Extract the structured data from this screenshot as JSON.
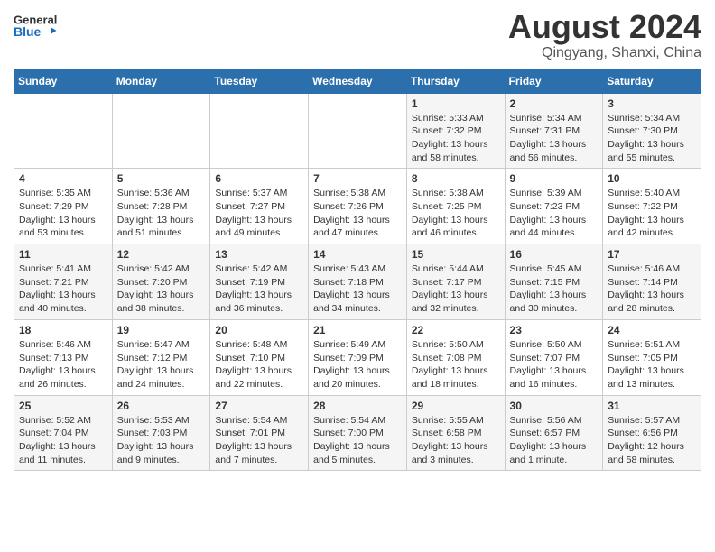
{
  "logo": {
    "line1": "General",
    "line2": "Blue"
  },
  "title": "August 2024",
  "location": "Qingyang, Shanxi, China",
  "weekdays": [
    "Sunday",
    "Monday",
    "Tuesday",
    "Wednesday",
    "Thursday",
    "Friday",
    "Saturday"
  ],
  "weeks": [
    [
      {
        "day": "",
        "content": ""
      },
      {
        "day": "",
        "content": ""
      },
      {
        "day": "",
        "content": ""
      },
      {
        "day": "",
        "content": ""
      },
      {
        "day": "1",
        "content": "Sunrise: 5:33 AM\nSunset: 7:32 PM\nDaylight: 13 hours\nand 58 minutes."
      },
      {
        "day": "2",
        "content": "Sunrise: 5:34 AM\nSunset: 7:31 PM\nDaylight: 13 hours\nand 56 minutes."
      },
      {
        "day": "3",
        "content": "Sunrise: 5:34 AM\nSunset: 7:30 PM\nDaylight: 13 hours\nand 55 minutes."
      }
    ],
    [
      {
        "day": "4",
        "content": "Sunrise: 5:35 AM\nSunset: 7:29 PM\nDaylight: 13 hours\nand 53 minutes."
      },
      {
        "day": "5",
        "content": "Sunrise: 5:36 AM\nSunset: 7:28 PM\nDaylight: 13 hours\nand 51 minutes."
      },
      {
        "day": "6",
        "content": "Sunrise: 5:37 AM\nSunset: 7:27 PM\nDaylight: 13 hours\nand 49 minutes."
      },
      {
        "day": "7",
        "content": "Sunrise: 5:38 AM\nSunset: 7:26 PM\nDaylight: 13 hours\nand 47 minutes."
      },
      {
        "day": "8",
        "content": "Sunrise: 5:38 AM\nSunset: 7:25 PM\nDaylight: 13 hours\nand 46 minutes."
      },
      {
        "day": "9",
        "content": "Sunrise: 5:39 AM\nSunset: 7:23 PM\nDaylight: 13 hours\nand 44 minutes."
      },
      {
        "day": "10",
        "content": "Sunrise: 5:40 AM\nSunset: 7:22 PM\nDaylight: 13 hours\nand 42 minutes."
      }
    ],
    [
      {
        "day": "11",
        "content": "Sunrise: 5:41 AM\nSunset: 7:21 PM\nDaylight: 13 hours\nand 40 minutes."
      },
      {
        "day": "12",
        "content": "Sunrise: 5:42 AM\nSunset: 7:20 PM\nDaylight: 13 hours\nand 38 minutes."
      },
      {
        "day": "13",
        "content": "Sunrise: 5:42 AM\nSunset: 7:19 PM\nDaylight: 13 hours\nand 36 minutes."
      },
      {
        "day": "14",
        "content": "Sunrise: 5:43 AM\nSunset: 7:18 PM\nDaylight: 13 hours\nand 34 minutes."
      },
      {
        "day": "15",
        "content": "Sunrise: 5:44 AM\nSunset: 7:17 PM\nDaylight: 13 hours\nand 32 minutes."
      },
      {
        "day": "16",
        "content": "Sunrise: 5:45 AM\nSunset: 7:15 PM\nDaylight: 13 hours\nand 30 minutes."
      },
      {
        "day": "17",
        "content": "Sunrise: 5:46 AM\nSunset: 7:14 PM\nDaylight: 13 hours\nand 28 minutes."
      }
    ],
    [
      {
        "day": "18",
        "content": "Sunrise: 5:46 AM\nSunset: 7:13 PM\nDaylight: 13 hours\nand 26 minutes."
      },
      {
        "day": "19",
        "content": "Sunrise: 5:47 AM\nSunset: 7:12 PM\nDaylight: 13 hours\nand 24 minutes."
      },
      {
        "day": "20",
        "content": "Sunrise: 5:48 AM\nSunset: 7:10 PM\nDaylight: 13 hours\nand 22 minutes."
      },
      {
        "day": "21",
        "content": "Sunrise: 5:49 AM\nSunset: 7:09 PM\nDaylight: 13 hours\nand 20 minutes."
      },
      {
        "day": "22",
        "content": "Sunrise: 5:50 AM\nSunset: 7:08 PM\nDaylight: 13 hours\nand 18 minutes."
      },
      {
        "day": "23",
        "content": "Sunrise: 5:50 AM\nSunset: 7:07 PM\nDaylight: 13 hours\nand 16 minutes."
      },
      {
        "day": "24",
        "content": "Sunrise: 5:51 AM\nSunset: 7:05 PM\nDaylight: 13 hours\nand 13 minutes."
      }
    ],
    [
      {
        "day": "25",
        "content": "Sunrise: 5:52 AM\nSunset: 7:04 PM\nDaylight: 13 hours\nand 11 minutes."
      },
      {
        "day": "26",
        "content": "Sunrise: 5:53 AM\nSunset: 7:03 PM\nDaylight: 13 hours\nand 9 minutes."
      },
      {
        "day": "27",
        "content": "Sunrise: 5:54 AM\nSunset: 7:01 PM\nDaylight: 13 hours\nand 7 minutes."
      },
      {
        "day": "28",
        "content": "Sunrise: 5:54 AM\nSunset: 7:00 PM\nDaylight: 13 hours\nand 5 minutes."
      },
      {
        "day": "29",
        "content": "Sunrise: 5:55 AM\nSunset: 6:58 PM\nDaylight: 13 hours\nand 3 minutes."
      },
      {
        "day": "30",
        "content": "Sunrise: 5:56 AM\nSunset: 6:57 PM\nDaylight: 13 hours\nand 1 minute."
      },
      {
        "day": "31",
        "content": "Sunrise: 5:57 AM\nSunset: 6:56 PM\nDaylight: 12 hours\nand 58 minutes."
      }
    ]
  ]
}
